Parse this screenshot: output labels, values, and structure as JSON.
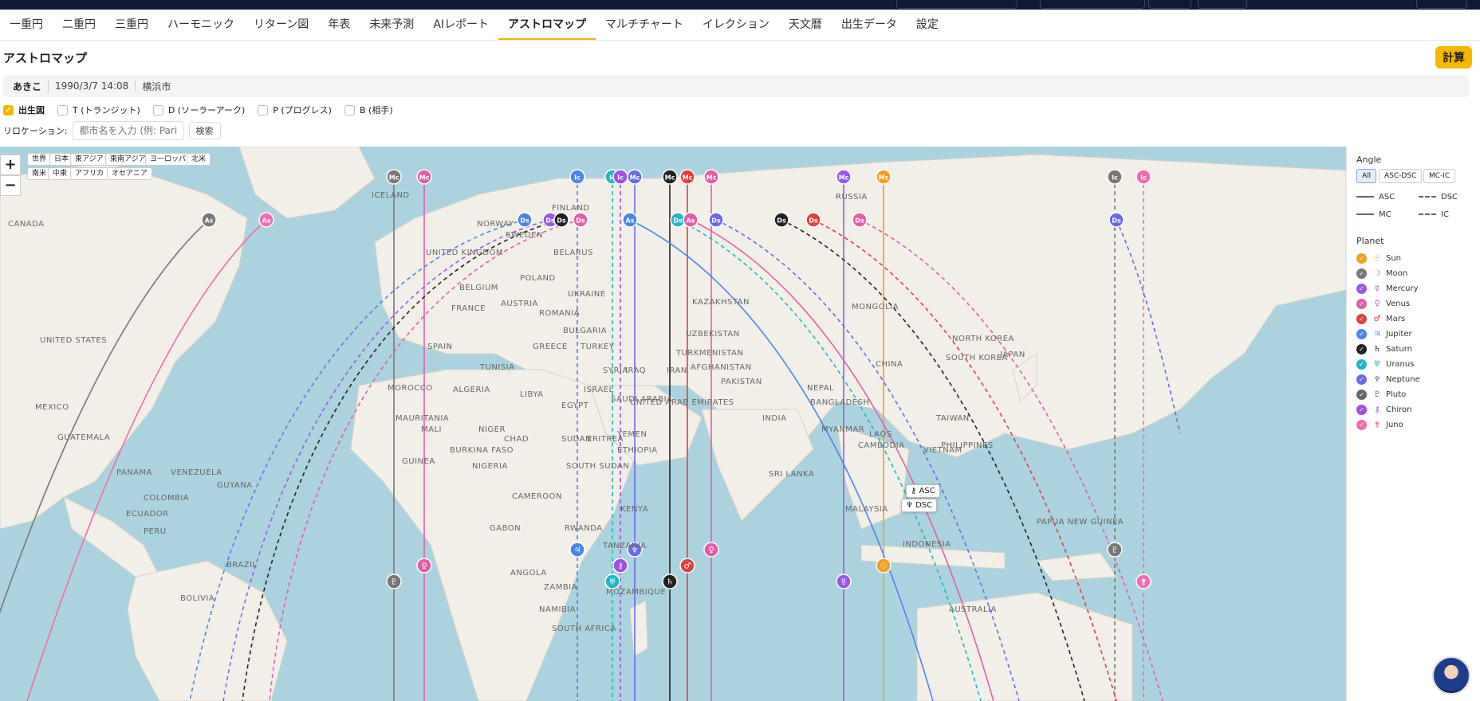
{
  "nav": {
    "tabs": [
      "一重円",
      "二重円",
      "三重円",
      "ハーモニック",
      "リターン図",
      "年表",
      "未来予測",
      "AIレポート",
      "アストロマップ",
      "マルチチャート",
      "イレクション",
      "天文暦",
      "出生データ",
      "設定"
    ],
    "active": "アストロマップ"
  },
  "page": {
    "title": "アストロマップ",
    "calc_label": "計算"
  },
  "profile": {
    "name": "あきこ",
    "birth": "1990/3/7 14:08",
    "place": "横浜市"
  },
  "charts": [
    {
      "label": "出生図",
      "checked": true
    },
    {
      "label": "T (トランジット)",
      "checked": false
    },
    {
      "label": "D (ソーラーアーク)",
      "checked": false
    },
    {
      "label": "P (プログレス)",
      "checked": false
    },
    {
      "label": "B (相手)",
      "checked": false
    }
  ],
  "relocation": {
    "label": "リロケーション:",
    "placeholder": "都市名を入力 (例: Paris)",
    "search_label": "検索"
  },
  "map": {
    "regions": [
      "世界",
      "日本",
      "東アジア",
      "東南アジア",
      "ヨーロッパ",
      "北米",
      "南米",
      "中東",
      "アフリカ",
      "オセアニア"
    ],
    "countries": [
      "ICELAND",
      "FINLAND",
      "RUSSIA",
      "CANADA",
      "NORWAY",
      "SWEDEN",
      "UNITED KINGDOM",
      "BELARUS",
      "POLAND",
      "UKRAINE",
      "BELGIUM",
      "FRANCE",
      "AUSTRIA",
      "ROMANIA",
      "BULGARIA",
      "KAZAKHSTAN",
      "MONGOLIA",
      "SPAIN",
      "GREECE",
      "TURKEY",
      "TURKMENISTAN",
      "UZBEKISTAN",
      "UNITED STATES",
      "TUNISIA",
      "SYRIA",
      "IRAQ",
      "IRAN",
      "AFGHANISTAN",
      "PAKISTAN",
      "CHINA",
      "NORTH KOREA",
      "SOUTH KOREA",
      "JAPAN",
      "MOROCCO",
      "ALGERIA",
      "LIBYA",
      "EGYPT",
      "ISRAEL",
      "SAUDI ARABIA",
      "UNITED ARAB EMIRATES",
      "NEPAL",
      "BANGLADESH",
      "INDIA",
      "TAIWAN",
      "MEXICO",
      "MAURITANIA",
      "MALI",
      "NIGER",
      "CHAD",
      "SUDAN",
      "ERITREA",
      "YEMEN",
      "MYANMAR",
      "LAOS",
      "VIETNAM",
      "PHILIPPINES",
      "CAMBODIA",
      "GUATEMALA",
      "BURKINA FASO",
      "GUINEA",
      "NIGERIA",
      "ETHIOPIA",
      "SOUTH SUDAN",
      "SRI LANKA",
      "PANAMA",
      "VENEZUELA",
      "GUYANA",
      "COLOMBIA",
      "CAMEROON",
      "GABON",
      "KENYA",
      "MALAYSIA",
      "ECUADOR",
      "RWANDA",
      "TANZANIA",
      "INDONESIA",
      "PAPUA NEW GUINEA",
      "PERU",
      "BRAZIL",
      "ANGOLA",
      "ZAMBIA",
      "BOLIVIA",
      "MOZAMBIQUE",
      "NAMIBIA",
      "SOUTH AFRICA",
      "AUSTRALIA"
    ],
    "tooltip_asc": "⚷ ASC",
    "tooltip_dsc": "♆ DSC",
    "zoom_in": "+",
    "zoom_out": "−"
  },
  "legend": {
    "angle_title": "Angle",
    "angle_buttons": [
      "All",
      "ASC-DSC",
      "MC-IC"
    ],
    "angle_active": "All",
    "lines": [
      {
        "label": "ASC",
        "style": "solid"
      },
      {
        "label": "DSC",
        "style": "dashed"
      },
      {
        "label": "MC",
        "style": "solid"
      },
      {
        "label": "IC",
        "style": "dashed"
      }
    ],
    "planet_title": "Planet",
    "planets": [
      {
        "name": "Sun",
        "glyph": "☉",
        "color": "#f0a020"
      },
      {
        "name": "Moon",
        "glyph": "☽",
        "color": "#777777"
      },
      {
        "name": "Mercury",
        "glyph": "☿",
        "color": "#9b59e6"
      },
      {
        "name": "Venus",
        "glyph": "♀",
        "color": "#e05fa8"
      },
      {
        "name": "Mars",
        "glyph": "♂",
        "color": "#e04040"
      },
      {
        "name": "Jupiter",
        "glyph": "♃",
        "color": "#4a86e8"
      },
      {
        "name": "Saturn",
        "glyph": "♄",
        "color": "#222222"
      },
      {
        "name": "Uranus",
        "glyph": "♅",
        "color": "#1fb6c8"
      },
      {
        "name": "Neptune",
        "glyph": "♆",
        "color": "#6a6ae8"
      },
      {
        "name": "Pluto",
        "glyph": "♇",
        "color": "#666666"
      },
      {
        "name": "Chiron",
        "glyph": "⚷",
        "color": "#a050e0"
      },
      {
        "name": "Juno",
        "glyph": "⚵",
        "color": "#f06cae"
      }
    ]
  },
  "markers": {
    "mc": [
      {
        "label": "Mc",
        "color": "#777777",
        "glyph": "♇"
      },
      {
        "label": "Mc",
        "color": "#e05fa8",
        "glyph": "♀"
      },
      {
        "label": "Ic",
        "color": "#4a86e8",
        "glyph": "♃"
      },
      {
        "label": "Ic",
        "color": "#1fb6c8",
        "glyph": "♅"
      },
      {
        "label": "Ic",
        "color": "#a050e0",
        "glyph": "⚷"
      },
      {
        "label": "Mc",
        "color": "#6a6ae8",
        "glyph": "♆"
      },
      {
        "label": "Mc",
        "color": "#222222",
        "glyph": "♄"
      },
      {
        "label": "Mc",
        "color": "#e04040",
        "glyph": "♂"
      },
      {
        "label": "Mc",
        "color": "#e05fa8",
        "glyph": "♀"
      },
      {
        "label": "Mc",
        "color": "#9b59e6",
        "glyph": "☿"
      },
      {
        "label": "Mc",
        "color": "#f0a020",
        "glyph": "☉"
      },
      {
        "label": "Ic",
        "color": "#777777",
        "glyph": "♇"
      },
      {
        "label": "Ic",
        "color": "#f06cae",
        "glyph": "⚵"
      }
    ],
    "asc_dsc": [
      {
        "label": "As",
        "color": "#777777"
      },
      {
        "label": "As",
        "color": "#f06cae"
      },
      {
        "label": "Ds",
        "color": "#4a86e8"
      },
      {
        "label": "Ds",
        "color": "#9b59e6"
      },
      {
        "label": "Ds",
        "color": "#222222"
      },
      {
        "label": "Ds",
        "color": "#e05fa8"
      },
      {
        "label": "As",
        "color": "#4a86e8"
      },
      {
        "label": "Ds",
        "color": "#1fb6c8"
      },
      {
        "label": "As",
        "color": "#e05fa8"
      },
      {
        "label": "Ds",
        "color": "#6a6ae8"
      },
      {
        "label": "Ds",
        "color": "#222222"
      },
      {
        "label": "Ds",
        "color": "#e04040"
      },
      {
        "label": "Ds",
        "color": "#e05fa8"
      },
      {
        "label": "Ds",
        "color": "#6a6ae8"
      }
    ]
  }
}
